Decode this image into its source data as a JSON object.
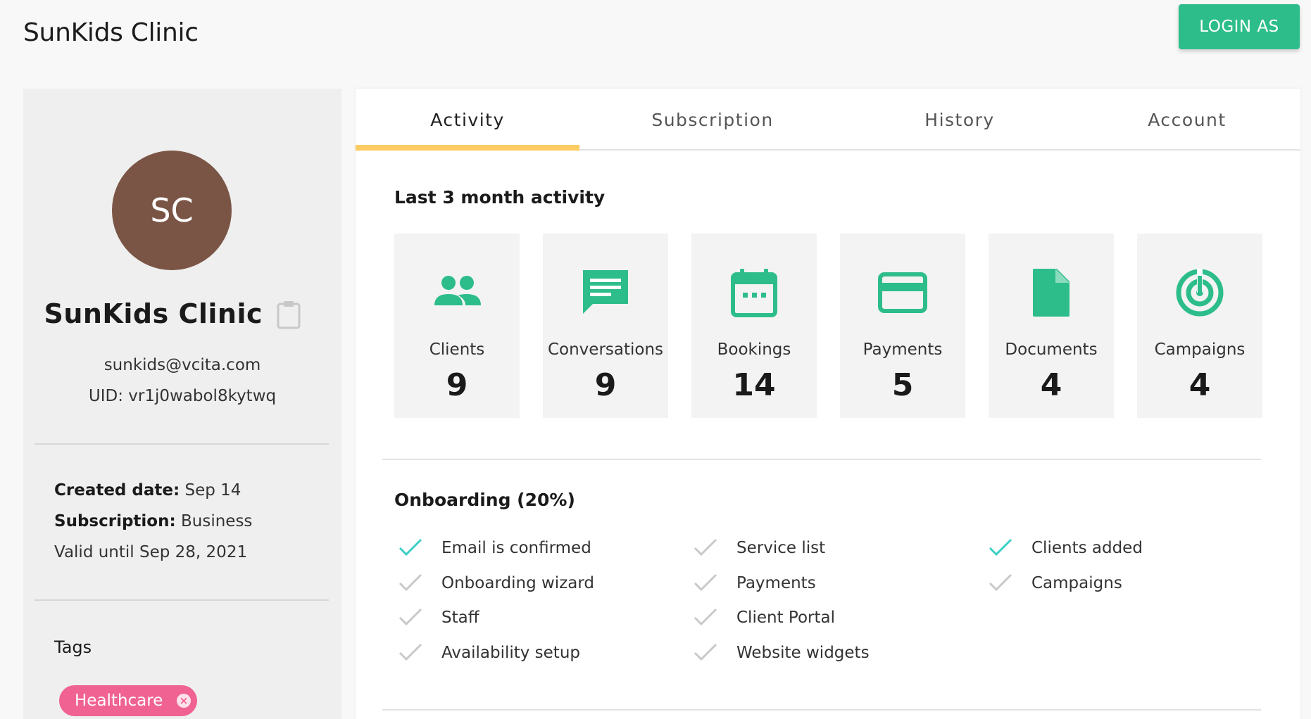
{
  "header": {
    "title": "SunKids Clinic",
    "login_label": "LOGIN AS"
  },
  "sidebar": {
    "avatar_initials": "SC",
    "org_name": "SunKids Clinic",
    "email": "sunkids@vcita.com",
    "uid": "UID: vr1j0wabol8kytwq",
    "created_label": "Created date:",
    "created_value": " Sep 14",
    "subscription_label": "Subscription:",
    "subscription_value": " Business",
    "valid_until": "Valid until Sep 28, 2021",
    "tags_title": "Tags",
    "tags": [
      {
        "label": "Healthcare",
        "color": "#f06292"
      }
    ]
  },
  "tabs": [
    {
      "label": "Activity",
      "active": true
    },
    {
      "label": "Subscription",
      "active": false
    },
    {
      "label": "History",
      "active": false
    },
    {
      "label": "Account",
      "active": false
    }
  ],
  "activity": {
    "title": "Last 3 month activity",
    "accent_color": "#2dbd8a",
    "stats": [
      {
        "label": "Clients",
        "value": "9",
        "icon": "clients-icon"
      },
      {
        "label": "Conversations",
        "value": "9",
        "icon": "conversations-icon"
      },
      {
        "label": "Bookings",
        "value": "14",
        "icon": "bookings-icon"
      },
      {
        "label": "Payments",
        "value": "5",
        "icon": "payments-icon"
      },
      {
        "label": "Documents",
        "value": "4",
        "icon": "documents-icon"
      },
      {
        "label": "Campaigns",
        "value": "4",
        "icon": "campaigns-icon"
      }
    ]
  },
  "onboarding": {
    "title": "Onboarding (20%)",
    "done_color": "#3ccfc5",
    "pending_color": "#c9c9c9",
    "columns": [
      [
        {
          "label": "Email is confirmed",
          "done": true
        },
        {
          "label": "Onboarding wizard",
          "done": false
        },
        {
          "label": "Staff",
          "done": false
        },
        {
          "label": "Availability setup",
          "done": false
        }
      ],
      [
        {
          "label": "Service list",
          "done": false
        },
        {
          "label": "Payments",
          "done": false
        },
        {
          "label": "Client Portal",
          "done": false
        },
        {
          "label": "Website widgets",
          "done": false
        }
      ],
      [
        {
          "label": "Clients added",
          "done": true
        },
        {
          "label": "Campaigns",
          "done": false
        }
      ]
    ]
  }
}
